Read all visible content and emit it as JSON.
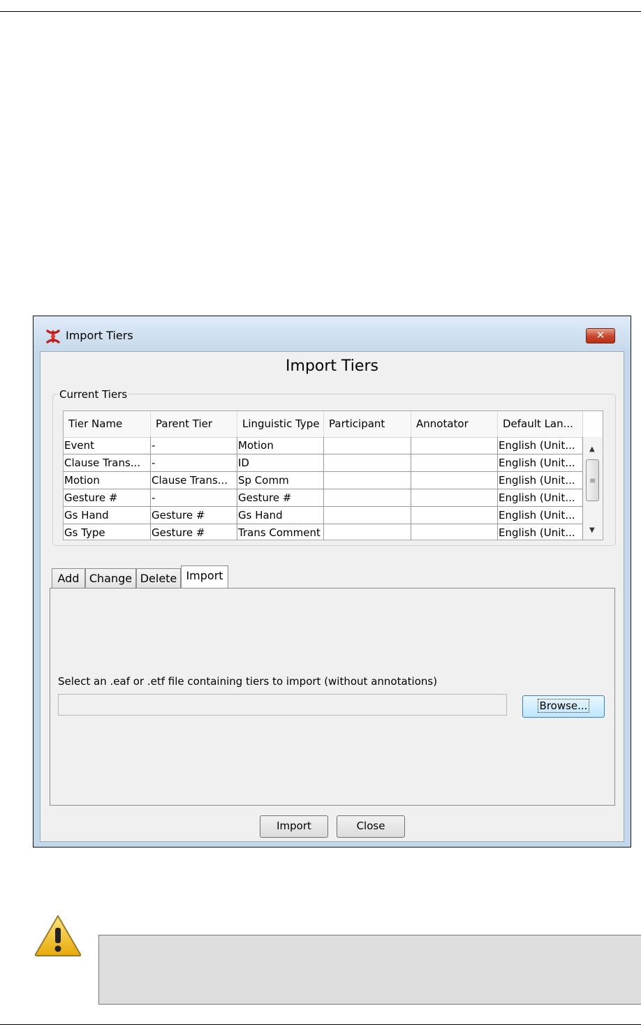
{
  "window": {
    "title": "Import Tiers",
    "heading": "Import Tiers",
    "close_glyph": "✕"
  },
  "current_tiers": {
    "group_label": "Current Tiers",
    "columns": [
      "Tier Name",
      "Parent Tier",
      "Linguistic Type",
      "Participant",
      "Annotator",
      "Default Lan..."
    ],
    "rows": [
      [
        "Event",
        "-",
        "Motion",
        "",
        "",
        "English (Unit..."
      ],
      [
        "Clause Trans...",
        "-",
        "ID",
        "",
        "",
        "English (Unit..."
      ],
      [
        "Motion",
        "Clause Trans...",
        "Sp Comm",
        "",
        "",
        "English (Unit..."
      ],
      [
        "Gesture #",
        "-",
        "Gesture #",
        "",
        "",
        "English (Unit..."
      ],
      [
        "Gs Hand",
        "Gesture #",
        "Gs Hand",
        "",
        "",
        "English (Unit..."
      ],
      [
        "Gs Type",
        "Gesture #",
        "Trans Comment",
        "",
        "",
        "English (Unit..."
      ]
    ]
  },
  "tabs": [
    {
      "label": "Add"
    },
    {
      "label": "Change"
    },
    {
      "label": "Delete"
    },
    {
      "label": "Import",
      "active": true
    }
  ],
  "import_panel": {
    "instruction": "Select an .eaf or .etf file containing tiers to import (without annotations)",
    "file_path_value": "",
    "browse_label": "Browse..."
  },
  "buttons": {
    "import_label": "Import",
    "close_label": "Close"
  },
  "icons": {
    "app": "elan-app-icon",
    "warning": "warning-icon"
  },
  "colors": {
    "titlebar": "#c7d9ec",
    "close_button": "#c8442a",
    "browse_button": "#bee6fd",
    "warning": "#f3c311"
  }
}
